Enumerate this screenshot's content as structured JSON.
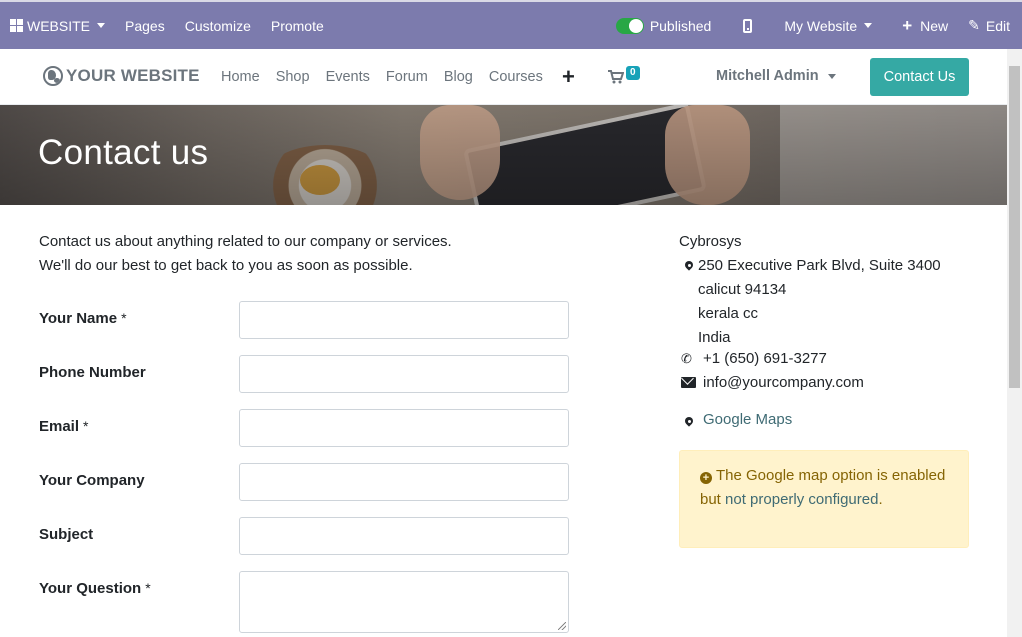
{
  "adminbar": {
    "website_label": "WEBSITE",
    "pages_label": "Pages",
    "customize_label": "Customize",
    "promote_label": "Promote",
    "published_label": "Published",
    "my_website_label": "My Website",
    "new_label": "New",
    "edit_label": "Edit"
  },
  "nav": {
    "logo_text": "YOUR WEBSITE",
    "menu": [
      "Home",
      "Shop",
      "Events",
      "Forum",
      "Blog",
      "Courses"
    ],
    "cart_count": "0",
    "user_name": "Mitchell Admin",
    "contact_button": "Contact Us"
  },
  "hero": {
    "title": "Contact us"
  },
  "intro": {
    "line1": "Contact us about anything related to our company or services.",
    "line2": "We'll do our best to get back to you as soon as possible."
  },
  "form": {
    "fields": [
      {
        "label": "Your Name",
        "required": "*"
      },
      {
        "label": "Phone Number",
        "required": ""
      },
      {
        "label": "Email",
        "required": "*"
      },
      {
        "label": "Your Company",
        "required": ""
      },
      {
        "label": "Subject",
        "required": ""
      },
      {
        "label": "Your Question",
        "required": "*"
      }
    ]
  },
  "company": {
    "name": "Cybrosys",
    "address": [
      "250 Executive Park Blvd, Suite 3400",
      "calicut 94134",
      "kerala cc",
      "India"
    ],
    "phone": "+1 (650) 691-3277",
    "email": "info@yourcompany.com",
    "maps_label": "Google Maps"
  },
  "alert": {
    "text_before": "The Google map option is enabled but ",
    "link_text": "not properly configured",
    "text_after": "."
  },
  "colors": {
    "adminbar": "#7c7bad",
    "primary_button": "#35a9a4",
    "alert_bg": "#fff3cd",
    "alert_text": "#856404",
    "link": "#3f6b74",
    "toggle_on": "#28a745",
    "badge": "#17a2b8"
  }
}
